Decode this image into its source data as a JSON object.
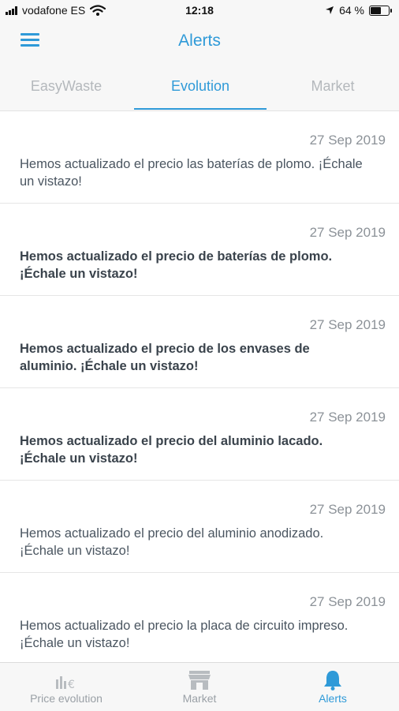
{
  "status_bar": {
    "carrier": "vodafone ES",
    "time": "12:18",
    "battery": "64 %",
    "battery_level": 0.64,
    "icons": [
      "signal-icon",
      "wifi-icon",
      "location-arrow-icon",
      "battery-icon"
    ]
  },
  "header": {
    "title": "Alerts",
    "menu_icon": "hamburger-menu-icon"
  },
  "tabs": [
    {
      "label": "EasyWaste",
      "active": false
    },
    {
      "label": "Evolution",
      "active": true
    },
    {
      "label": "Market",
      "active": false
    }
  ],
  "alerts": [
    {
      "date": "27 Sep 2019",
      "message": "Hemos actualizado el precio las baterías de plomo. ¡Échale un vistazo!",
      "unread": false
    },
    {
      "date": "27 Sep 2019",
      "message": "Hemos actualizado el precio de baterías de plomo. ¡Échale un vistazo!",
      "unread": true
    },
    {
      "date": "27 Sep 2019",
      "message": "Hemos actualizado el precio  de los envases de aluminio. ¡Échale un vistazo!",
      "unread": true
    },
    {
      "date": "27 Sep 2019",
      "message": "Hemos actualizado el precio del aluminio lacado. ¡Échale un vistazo!",
      "unread": true
    },
    {
      "date": "27 Sep 2019",
      "message": "Hemos actualizado el precio del aluminio anodizado. ¡Échale un vistazo!",
      "unread": false
    },
    {
      "date": "27 Sep 2019",
      "message": "Hemos actualizado el precio la placa de  circuito impreso. ¡Échale un vistazo!",
      "unread": false
    }
  ],
  "bottom_nav": [
    {
      "label": "Price evolution",
      "icon": "price-evolution-icon",
      "active": false
    },
    {
      "label": "Market",
      "icon": "market-store-icon",
      "active": false
    },
    {
      "label": "Alerts",
      "icon": "bell-icon",
      "active": true
    }
  ],
  "colors": {
    "accent": "#2f9ad8",
    "inactive": "#b4b8bc",
    "background": "#f7f7f7"
  }
}
